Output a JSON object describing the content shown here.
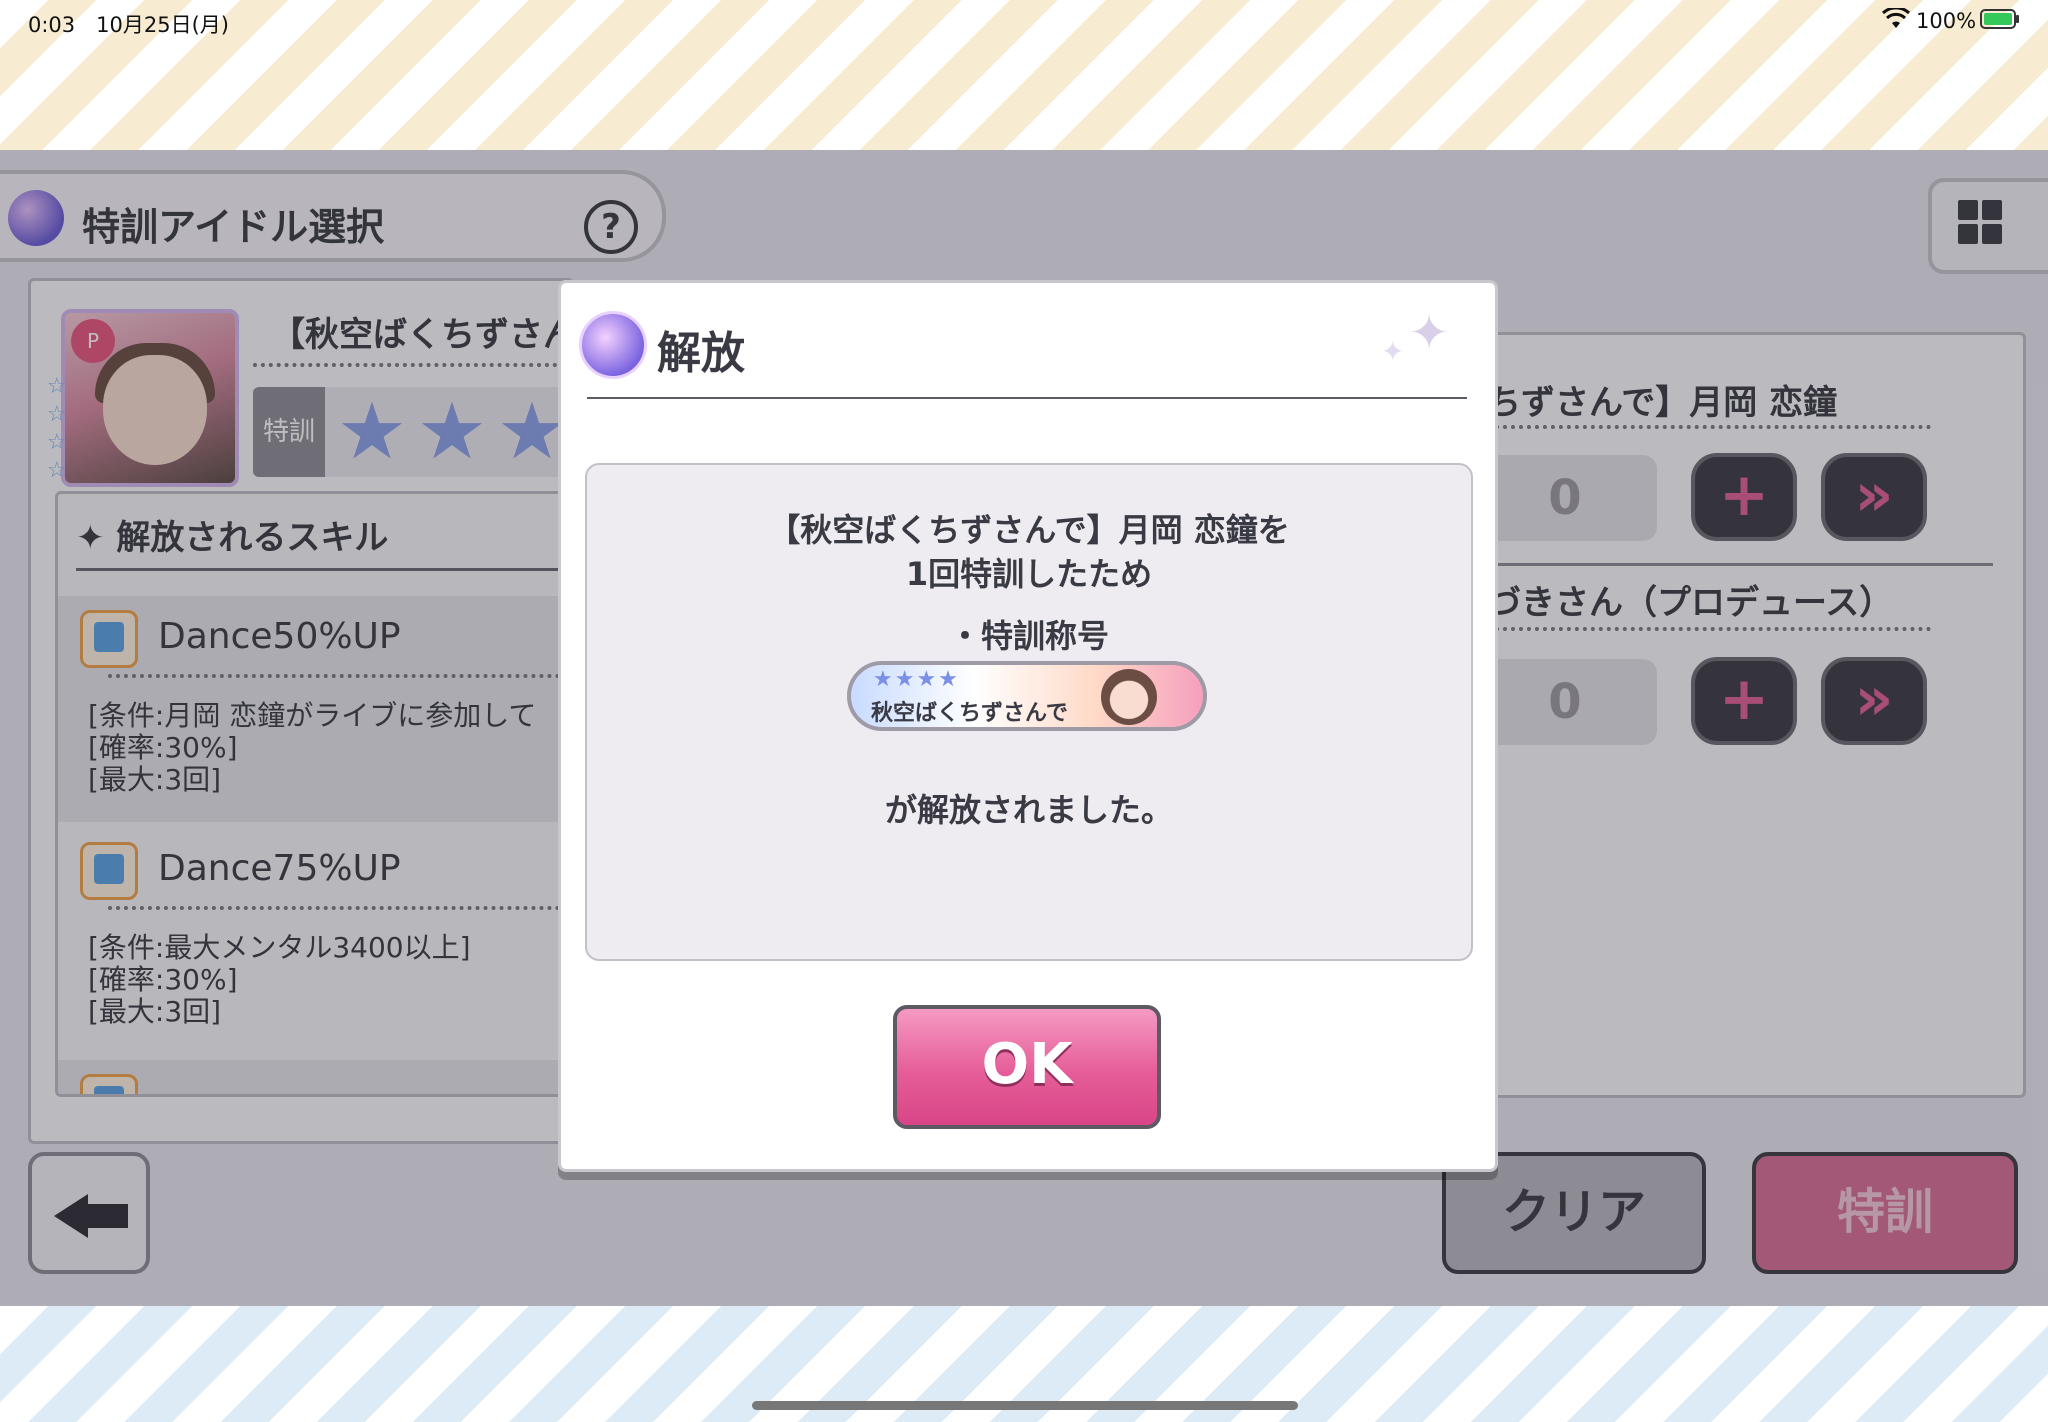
{
  "status_bar": {
    "time": "0:03　10月25日(月)",
    "battery": "100%"
  },
  "header": {
    "title": "特訓アイドル選択",
    "help_label": "?"
  },
  "left_panel": {
    "card_name": "【秋空ばくちずさんで】月岡 恋鐘",
    "rank_label": "特訓",
    "skills_title": "✦ 解放されるスキル",
    "skills": [
      {
        "name": "Dance50%UP",
        "desc": "[条件:月岡 恋鐘がライブに参加して\n[確率:30%]\n[最大:3回]"
      },
      {
        "name": "Dance75%UP",
        "desc": "[条件:最大メンタル3400以上]\n[確率:30%]\n[最大:3回]"
      }
    ]
  },
  "right_panel": {
    "item1_name": "ちずさんで】月岡 恋鐘",
    "item1_count": "0",
    "item2_name": "づきさん（プロデュース）",
    "item2_count": "0"
  },
  "footer": {
    "clear_label": "クリア",
    "train_label": "特訓"
  },
  "modal": {
    "title": "解放",
    "line1": "【秋空ばくちずさんで】月岡 恋鐘を",
    "line2": "1回特訓したため",
    "bullet": "・特訓称号",
    "plate_text": "秋空ばくちずさんで",
    "plate_stars": "★★★★",
    "released": "が解放されました。",
    "ok_label": "OK"
  }
}
